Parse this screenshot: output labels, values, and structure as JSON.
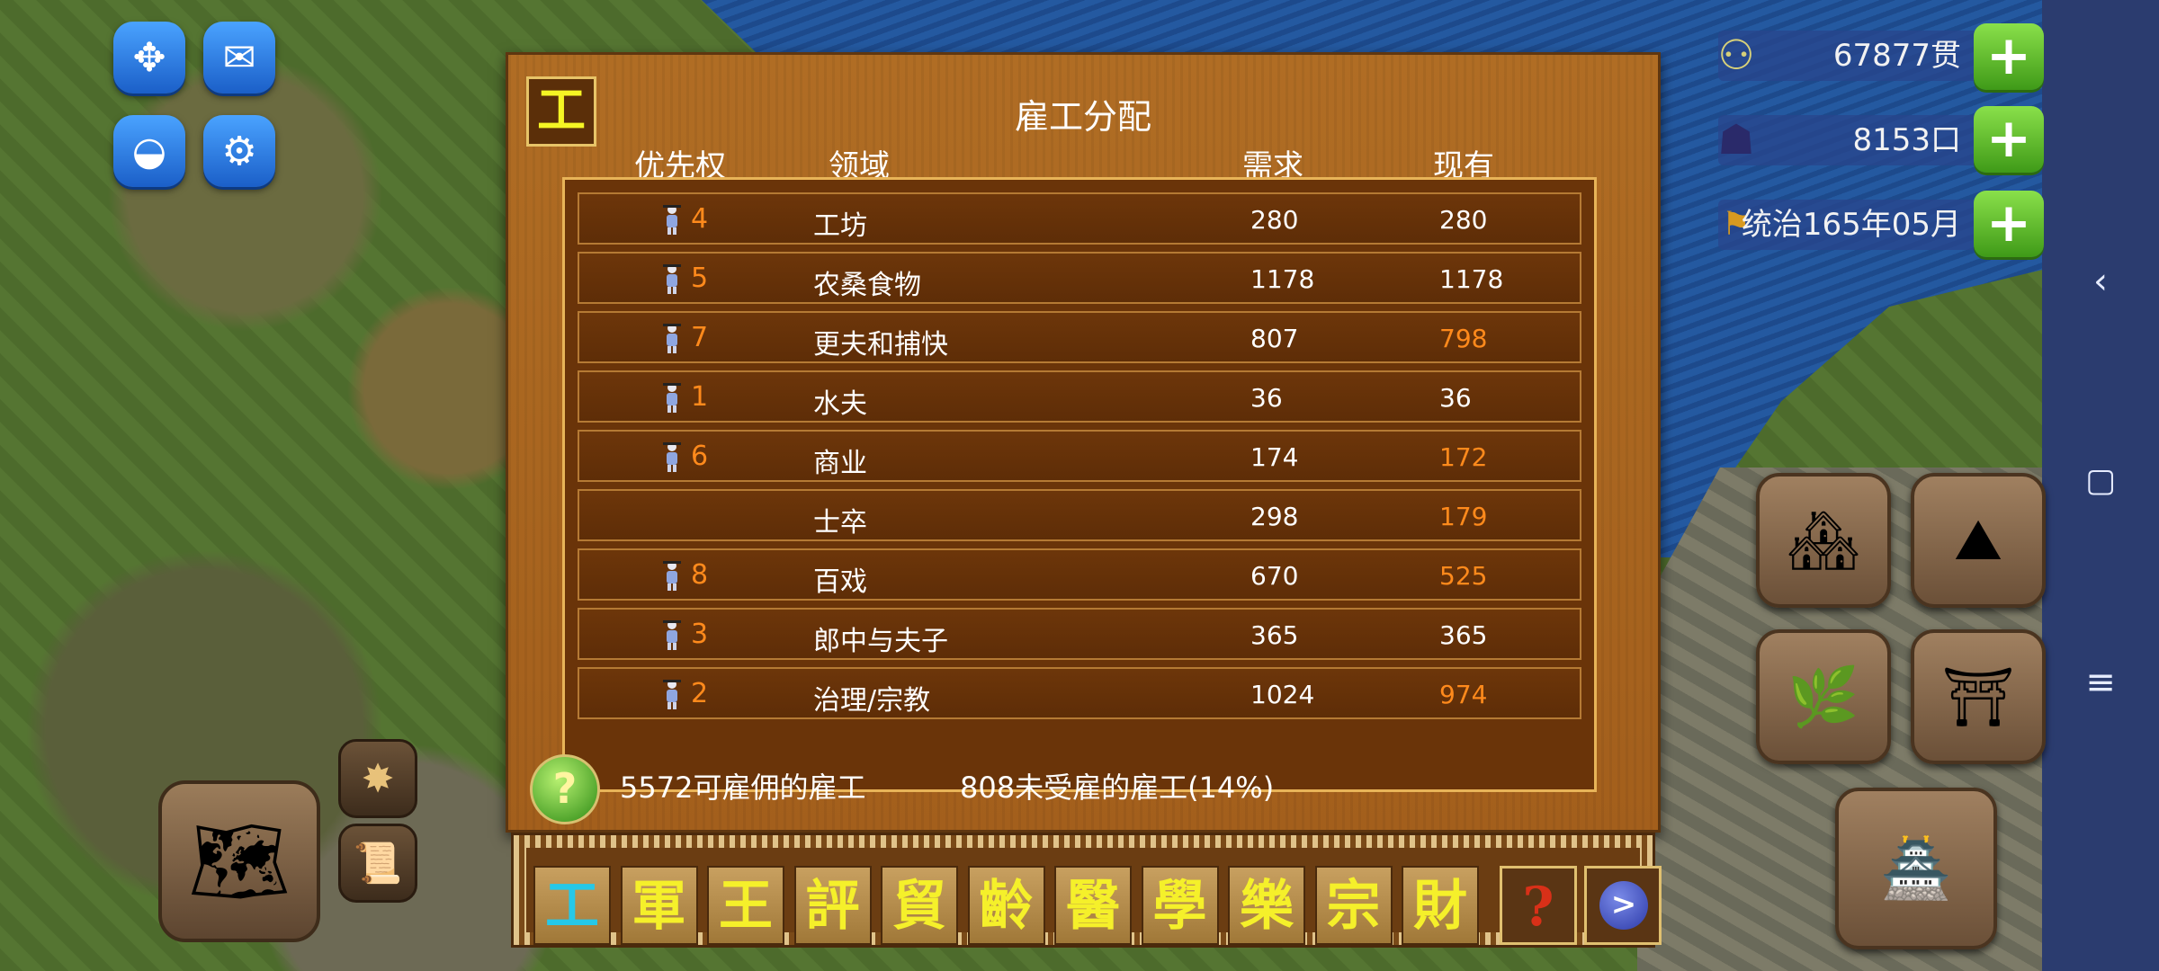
{
  "panel": {
    "badge": "工",
    "title": "雇工分配",
    "headers": {
      "priority": "优先权",
      "field": "领域",
      "demand": "需求",
      "current": "现有"
    },
    "rows": [
      {
        "priority": "4",
        "field": "工坊",
        "demand": "280",
        "current": "280",
        "short": false
      },
      {
        "priority": "5",
        "field": "农桑食物",
        "demand": "1178",
        "current": "1178",
        "short": false
      },
      {
        "priority": "7",
        "field": "更夫和捕快",
        "demand": "807",
        "current": "798",
        "short": true
      },
      {
        "priority": "1",
        "field": "水夫",
        "demand": "36",
        "current": "36",
        "short": false
      },
      {
        "priority": "6",
        "field": "商业",
        "demand": "174",
        "current": "172",
        "short": true
      },
      {
        "priority": "",
        "field": "士卒",
        "demand": "298",
        "current": "179",
        "short": true
      },
      {
        "priority": "8",
        "field": "百戏",
        "demand": "670",
        "current": "525",
        "short": true
      },
      {
        "priority": "3",
        "field": "郎中与夫子",
        "demand": "365",
        "current": "365",
        "short": false
      },
      {
        "priority": "2",
        "field": "治理/宗教",
        "demand": "1024",
        "current": "974",
        "short": true
      }
    ],
    "available_workers": "5572可雇佣的雇工",
    "unemployed_workers": "808未受雇的雇工(14%)",
    "help_glyph": "?"
  },
  "resources": {
    "money": "67877贯",
    "population": "8153口",
    "reign": "统治165年05月",
    "plus_glyph": "+"
  },
  "toolbar": {
    "buttons": [
      "工",
      "軍",
      "王",
      "評",
      "貿",
      "齡",
      "醫",
      "學",
      "樂",
      "宗",
      "財"
    ],
    "help_glyph": "?",
    "next_glyph": ">"
  },
  "system_nav": {
    "back": "‹",
    "home": "▢",
    "menu": "≡"
  },
  "icons": {
    "move": "move-icon",
    "mail": "mail-icon",
    "globe": "globe-icon",
    "settings": "gear-icon",
    "coins": "coins-icon",
    "people": "people-icon",
    "banner": "banner-icon",
    "map": "map-icon",
    "star": "star-icon",
    "scroll": "scroll-icon",
    "housing": "housing-icon",
    "road": "road-icon",
    "farm": "farm-icon",
    "temple": "temple-icon",
    "city": "city-overview-icon"
  },
  "colors": {
    "shortage": "#ff8a1c",
    "active_toolbar": "#26c8e8",
    "toolbar_glyph": "#f5f02a",
    "panel": "#a35f1c",
    "plus_button": "#3f9a18"
  }
}
